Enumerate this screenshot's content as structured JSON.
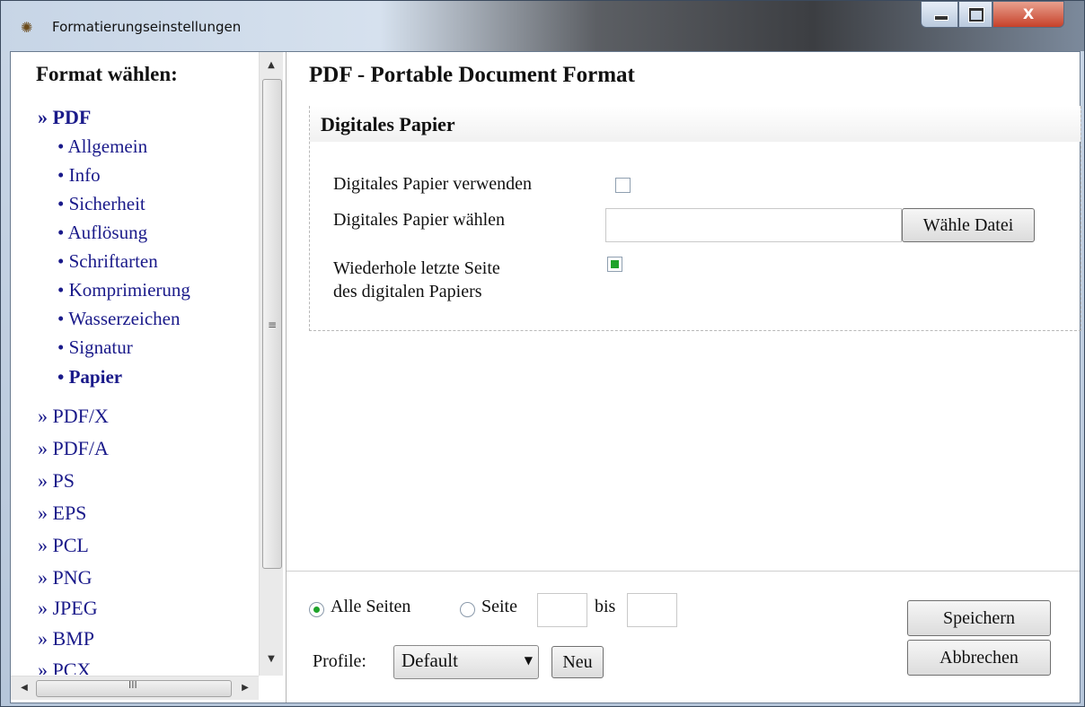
{
  "window": {
    "title": "Formatierungseinstellungen",
    "close_label": "X"
  },
  "sidebar": {
    "heading": "Format wählen:",
    "formats": [
      {
        "label": "» PDF",
        "active": true
      },
      {
        "label": "» PDF/X"
      },
      {
        "label": "» PDF/A"
      },
      {
        "label": "» PS"
      },
      {
        "label": "» EPS"
      },
      {
        "label": "» PCL"
      },
      {
        "label": "» PNG"
      },
      {
        "label": "» JPEG"
      },
      {
        "label": "» BMP"
      },
      {
        "label": "» PCX"
      }
    ],
    "pdf_subitems": [
      {
        "label": "• Allgemein"
      },
      {
        "label": "• Info"
      },
      {
        "label": "• Sicherheit"
      },
      {
        "label": "• Auflösung"
      },
      {
        "label": "• Schriftarten"
      },
      {
        "label": "• Komprimierung"
      },
      {
        "label": "• Wasserzeichen"
      },
      {
        "label": "• Signatur"
      },
      {
        "label": "• Papier",
        "active": true
      }
    ],
    "vscroll_grip": "≡",
    "hscroll_grip": "III"
  },
  "main": {
    "title": "PDF - Portable Document Format",
    "group": {
      "title": "Digitales Papier",
      "use_label": "Digitales Papier verwenden",
      "use_checked": false,
      "choose_label": "Digitales Papier wählen",
      "choose_value": "",
      "choose_button": "Wähle Datei",
      "repeat_label_line1": "Wiederhole letzte Seite",
      "repeat_label_line2": "des digitalen Papiers",
      "repeat_checked": true
    }
  },
  "bottom": {
    "all_pages_label": "Alle Seiten",
    "all_pages_selected": true,
    "page_label": "Seite",
    "page_from": "",
    "to_label": "bis",
    "page_to": "",
    "profile_label": "Profile:",
    "profile_value": "Default",
    "new_button": "Neu",
    "save_button": "Speichern",
    "cancel_button": "Abbrechen"
  },
  "colors": {
    "link": "#1a1a8a",
    "check_green": "#1fa32a"
  }
}
